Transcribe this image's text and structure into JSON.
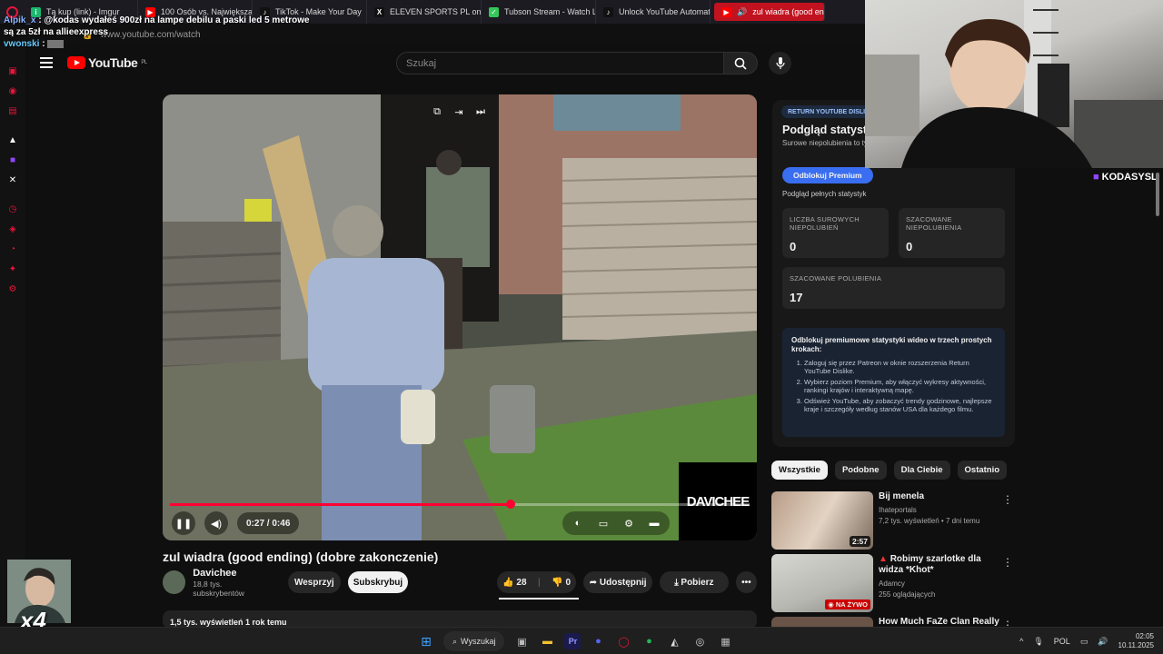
{
  "tabs": [
    {
      "label": "Tą kup (link) - Imgur",
      "color": "#1bb76e",
      "glyph": "i"
    },
    {
      "label": "100 Osób vs. Największa",
      "color": "#ff0000",
      "glyph": "▶"
    },
    {
      "label": "TikTok - Make Your Day",
      "color": "#111111",
      "glyph": "♪"
    },
    {
      "label": "ELEVEN SPORTS PL on X",
      "color": "#111111",
      "glyph": "X"
    },
    {
      "label": "Tubson Stream - Watch Live",
      "color": "#34c759",
      "glyph": "✓"
    },
    {
      "label": "Unlock YouTube Automation",
      "color": "#111111",
      "glyph": "♪"
    },
    {
      "label": "zul wiadra (good ending) (dob",
      "color": "#ff0000",
      "glyph": "▶"
    }
  ],
  "chat": {
    "user1": "Alpik_x",
    "message1": ": @kodas wydałeś 900zł na lampe debilu a paski led 5 metrowe są za 5zł na allieexpress",
    "user2": "vwonski",
    "message2": ":"
  },
  "address": {
    "url": "www.youtube.com/watch"
  },
  "header": {
    "logo_text": "YouTube",
    "region": "PL",
    "search_placeholder": "Szukaj"
  },
  "video": {
    "current_time": "0:27",
    "duration": "0:46",
    "progress_fraction": 0.587,
    "watermark": "DAVICHEE",
    "title": "zul wiadra (good ending) (dobre zakonczenie)"
  },
  "channel": {
    "name": "Davichee",
    "subs": "18,8 tys. subskrybentów",
    "support_label": "Wesprzyj",
    "subscribe_label": "Subskrybuj",
    "likes": "28",
    "dislikes": "0",
    "share_label": "Udostępnij",
    "download_label": "Pobierz"
  },
  "description": {
    "meta": "1,5 tys. wyświetleń  1 rok temu"
  },
  "dislike_panel": {
    "badge": "RETURN YOUTUBE DISLIKE",
    "title": "Podgląd statystyk",
    "desc": "Surowe niepolubienia to tylko dane od użytkowników rozszerzenia",
    "unlock_button": "Odblokuj Premium",
    "note": "Podgląd pełnych statystyk",
    "stat1_label": "LICZBA SUROWYCH NIEPOLUBIEŃ",
    "stat1_value": "0",
    "stat2_label": "SZACOWANE NIEPOLUBIENIA",
    "stat2_value": "0",
    "stat3_label": "SZACOWANE POLUBIENIA",
    "stat3_value": "17",
    "info_title": "Odblokuj premiumowe statystyki wideo w trzech prostych krokach:",
    "steps": [
      "Zaloguj się przez Patreon w oknie rozszerzenia Return YouTube Dislike.",
      "Wybierz poziom Premium, aby włączyć wykresy aktywności, rankingi krajów i interaktywną mapę.",
      "Odśwież YouTube, aby zobaczyć trendy godzinowe, najlepsze kraje i szczegóły według stanów USA dla każdego filmu."
    ]
  },
  "chips": [
    "Wszystkie",
    "Podobne",
    "Dla Ciebie",
    "Ostatnio"
  ],
  "recommendations": [
    {
      "title": "Bij menela",
      "channel": "Ihateportals",
      "meta": "7,2 tys. wyświetleń • 7 dni temu",
      "duration": "2:57"
    },
    {
      "title": "Robimy szarlotke dla widza *Khot*",
      "channel": "Adamcy",
      "meta": "255 oglądających",
      "badge": "NA ŻYWO"
    },
    {
      "title": "How Much FaZe Clan Really"
    }
  ],
  "streamer": {
    "name": "KODASYSL",
    "multiplier": "x4"
  },
  "taskbar": {
    "search_label": "Wyszukaj",
    "lang": "POL",
    "time": "02:05",
    "date": "10.11.2025"
  }
}
